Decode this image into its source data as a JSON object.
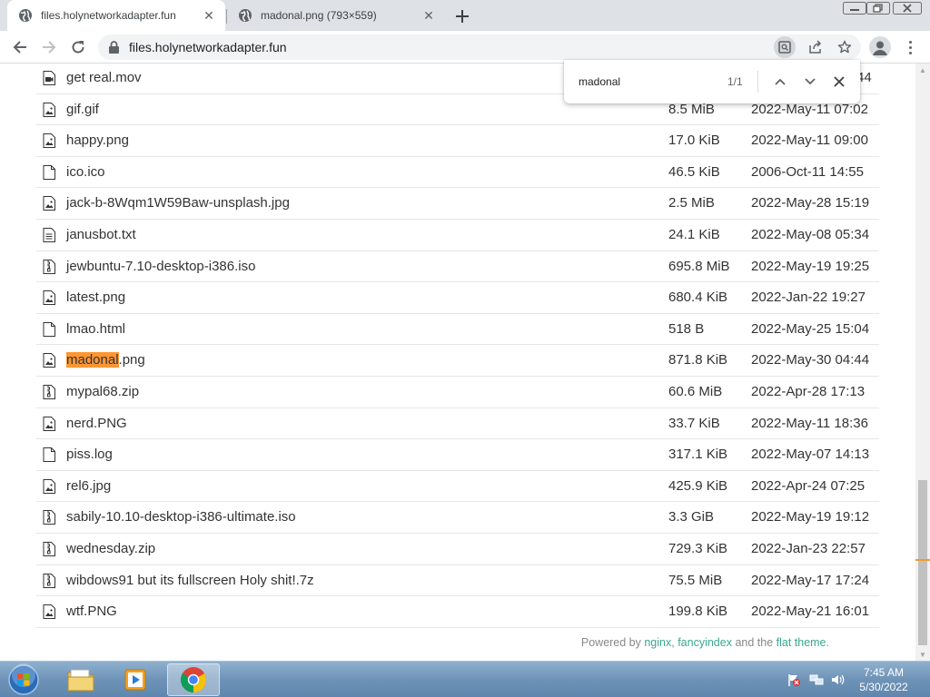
{
  "browser": {
    "tabs": [
      {
        "title": "files.holynetworkadapter.fun",
        "active": true
      },
      {
        "title": "madonal.png (793×559)",
        "active": false
      }
    ],
    "url": "files.holynetworkadapter.fun"
  },
  "find_bar": {
    "query": "madonal",
    "count": "1/1"
  },
  "files": [
    {
      "name_pre": "",
      "name_match": "",
      "name_post": "get real.mov",
      "size": "",
      "date": "44",
      "icon": "video-file-icon"
    },
    {
      "name_pre": "",
      "name_match": "",
      "name_post": "gif.gif",
      "size": "8.5 MiB",
      "date": "2022-May-11 07:02",
      "icon": "image-file-icon"
    },
    {
      "name_pre": "",
      "name_match": "",
      "name_post": "happy.png",
      "size": "17.0 KiB",
      "date": "2022-May-11 09:00",
      "icon": "image-file-icon"
    },
    {
      "name_pre": "",
      "name_match": "",
      "name_post": "ico.ico",
      "size": "46.5 KiB",
      "date": "2006-Oct-11 14:55",
      "icon": "blank-file-icon"
    },
    {
      "name_pre": "",
      "name_match": "",
      "name_post": "jack-b-8Wqm1W59Baw-unsplash.jpg",
      "size": "2.5 MiB",
      "date": "2022-May-28 15:19",
      "icon": "image-file-icon"
    },
    {
      "name_pre": "",
      "name_match": "",
      "name_post": "janusbot.txt",
      "size": "24.1 KiB",
      "date": "2022-May-08 05:34",
      "icon": "text-file-icon"
    },
    {
      "name_pre": "",
      "name_match": "",
      "name_post": "jewbuntu-7.10-desktop-i386.iso",
      "size": "695.8 MiB",
      "date": "2022-May-19 19:25",
      "icon": "archive-file-icon"
    },
    {
      "name_pre": "",
      "name_match": "",
      "name_post": "latest.png",
      "size": "680.4 KiB",
      "date": "2022-Jan-22 19:27",
      "icon": "image-file-icon"
    },
    {
      "name_pre": "",
      "name_match": "",
      "name_post": "lmao.html",
      "size": "518 B",
      "date": "2022-May-25 15:04",
      "icon": "blank-file-icon"
    },
    {
      "name_pre": "",
      "name_match": "madonal",
      "name_post": ".png",
      "size": "871.8 KiB",
      "date": "2022-May-30 04:44",
      "icon": "image-file-icon"
    },
    {
      "name_pre": "",
      "name_match": "",
      "name_post": "mypal68.zip",
      "size": "60.6 MiB",
      "date": "2022-Apr-28 17:13",
      "icon": "archive-file-icon"
    },
    {
      "name_pre": "",
      "name_match": "",
      "name_post": "nerd.PNG",
      "size": "33.7 KiB",
      "date": "2022-May-11 18:36",
      "icon": "image-file-icon"
    },
    {
      "name_pre": "",
      "name_match": "",
      "name_post": "piss.log",
      "size": "317.1 KiB",
      "date": "2022-May-07 14:13",
      "icon": "blank-file-icon"
    },
    {
      "name_pre": "",
      "name_match": "",
      "name_post": "rel6.jpg",
      "size": "425.9 KiB",
      "date": "2022-Apr-24 07:25",
      "icon": "image-file-icon"
    },
    {
      "name_pre": "",
      "name_match": "",
      "name_post": "sabily-10.10-desktop-i386-ultimate.iso",
      "size": "3.3 GiB",
      "date": "2022-May-19 19:12",
      "icon": "archive-file-icon"
    },
    {
      "name_pre": "",
      "name_match": "",
      "name_post": "wednesday.zip",
      "size": "729.3 KiB",
      "date": "2022-Jan-23 22:57",
      "icon": "archive-file-icon"
    },
    {
      "name_pre": "",
      "name_match": "",
      "name_post": "wibdows91 but its fullscreen Holy shit!.7z",
      "size": "75.5 MiB",
      "date": "2022-May-17 17:24",
      "icon": "archive-file-icon"
    },
    {
      "name_pre": "",
      "name_match": "",
      "name_post": "wtf.PNG",
      "size": "199.8 KiB",
      "date": "2022-May-21 16:01",
      "icon": "image-file-icon"
    }
  ],
  "footer": {
    "prefix": "Powered by ",
    "nginx": "nginx",
    "sep": ", ",
    "fancyindex": "fancyindex",
    "middle": " and the ",
    "theme": "flat theme",
    "suffix": "."
  },
  "taskbar": {
    "time": "7:45 AM",
    "date": "5/30/2022"
  },
  "colors": {
    "find_highlight": "#ff9632",
    "link": "#3aa88f"
  }
}
